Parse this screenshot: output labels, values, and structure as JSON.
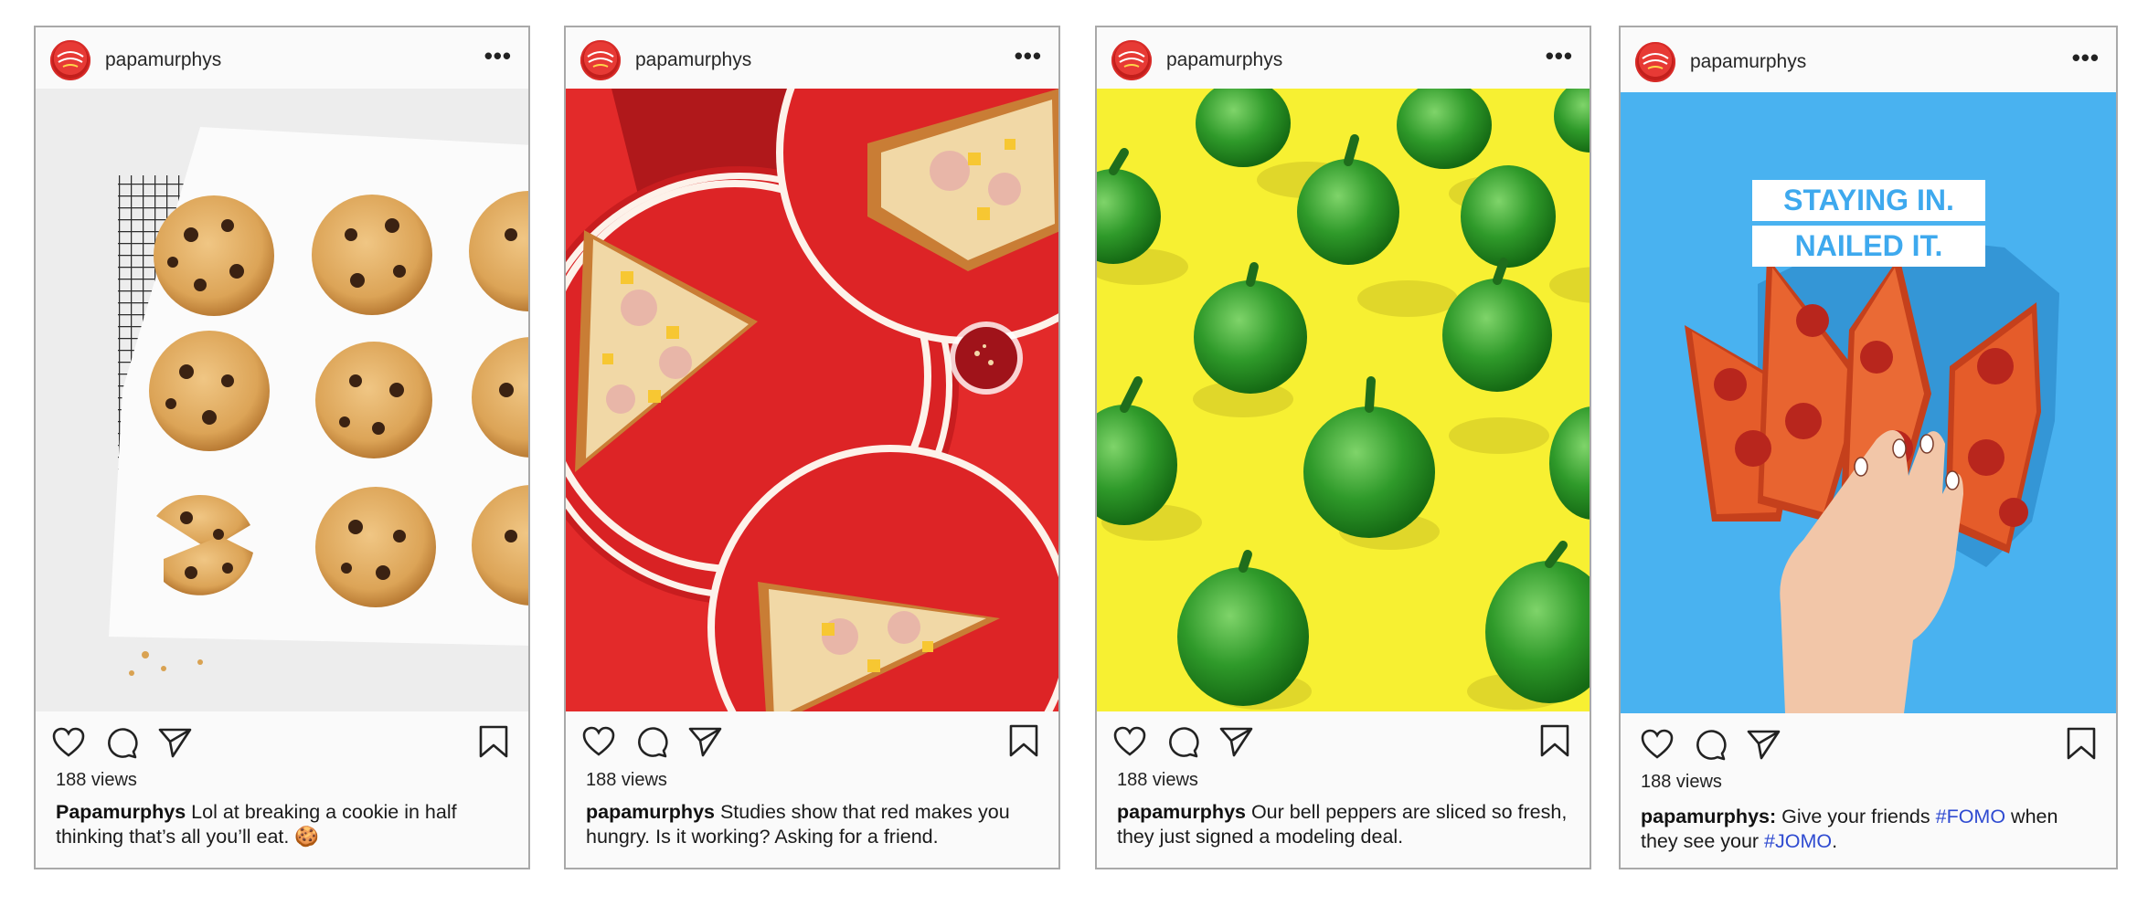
{
  "posts": [
    {
      "username": "papamurphys",
      "more": "•••",
      "views": "188 views",
      "caption_user": "Papamurphys",
      "caption_text": " Lol at breaking a cookie in half thinking that’s all you’ll eat. 🍪",
      "image": "chocolate-chip-cookies-on-cooling-rack"
    },
    {
      "username": "papamurphys",
      "more": "•••",
      "views": "188 views",
      "caption_user": "papamurphys",
      "caption_text": " Studies show that red makes you hungry. Is it working? Asking for a friend.",
      "image": "pizza-slices-on-red-plates"
    },
    {
      "username": "papamurphys",
      "more": "•••",
      "views": "188 views",
      "caption_user": "papamurphys",
      "caption_text": " Our bell peppers are sliced so fresh, they just signed a modeling deal.",
      "image": "green-bell-peppers-on-yellow"
    },
    {
      "username": "papamurphys",
      "more": "•••",
      "views": "188 views",
      "caption_user": "papamurphys:",
      "caption_pre": " Give your friends ",
      "caption_tag1": "#FOMO",
      "caption_mid": " when they see your ",
      "caption_tag2": "#JOMO",
      "caption_post": ".",
      "image": "hand-holding-pepperoni-pizza-slices",
      "overlay_line1": "STAYING IN.",
      "overlay_line2": "NAILED IT."
    }
  ],
  "icons": [
    "heart-icon",
    "comment-icon",
    "share-icon",
    "bookmark-icon"
  ],
  "colors": {
    "brand_red": "#d92b28",
    "post_bg": "#fafafa",
    "border": "#a9a9a9",
    "hashtag": "#2f4bd1"
  }
}
